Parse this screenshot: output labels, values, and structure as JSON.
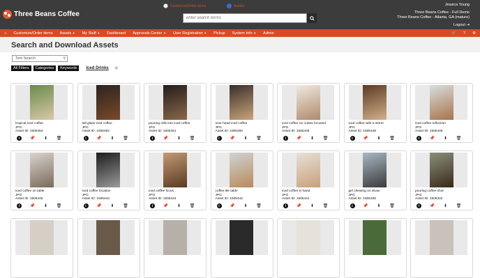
{
  "header": {
    "logo_text": "Three Beans Coffee",
    "radio_options": [
      {
        "label": "Customize/Order items",
        "selected": false
      },
      {
        "label": "Assets",
        "selected": true
      }
    ],
    "search_placeholder": "enter search terms",
    "user_name": "Jessica Young",
    "org_line1": "Three Beans Coffee - Full Demo",
    "org_line2": "Three Beans Coffee - Atlanta, GA (mature)",
    "logout": "Logout"
  },
  "nav": {
    "items": [
      "Customize/Order items",
      "Assets",
      "My Stuff",
      "Dashboard",
      "Approvals Center",
      "User Registration",
      "Pickup",
      "System Info",
      "Admin"
    ],
    "help": "?"
  },
  "page": {
    "title": "Search and Download Assets",
    "text_search_placeholder": "Text Search",
    "tabs": [
      "All Filters",
      "Categories",
      "Keywords"
    ],
    "active_filter": "Iced Drinks"
  },
  "assets": [
    {
      "name": "tropical iced coffee",
      "type": "JPG",
      "id": "Asset ID: 1505453",
      "c1": "#6a8a4a",
      "c2": "#d9c9a9"
    },
    {
      "name": "tall glass iced coffee",
      "type": "JPG",
      "id": "Asset ID: 1505452",
      "c1": "#2c2320",
      "c2": "#7a4a2a"
    },
    {
      "name": "pouring milk into iced coffee",
      "type": "JPG",
      "id": "Asset ID: 1505451",
      "c1": "#221c1a",
      "c2": "#8a6a4a"
    },
    {
      "name": "over head iced coffee",
      "type": "JPG",
      "id": "Asset ID: 1505450",
      "c1": "#3a2f2a",
      "c2": "#c9a47a"
    },
    {
      "name": "iced coffee ice cubes focused",
      "type": "JPG",
      "id": "Asset ID: 1505449",
      "c1": "#efe9e2",
      "c2": "#b08a6a"
    },
    {
      "name": "iced coffee with a stirrer",
      "type": "JPG",
      "id": "Asset ID: 1505448",
      "c1": "#5a3a22",
      "c2": "#d2b08a"
    },
    {
      "name": "iced coffee reflection",
      "type": "JPG",
      "id": "Asset ID: 1505446",
      "c1": "#d8dee0",
      "c2": "#a8734a"
    },
    {
      "name": "iced coffee on table",
      "type": "JPG",
      "id": "Asset ID: 1505445",
      "c1": "#d9d4cc",
      "c2": "#7a6a5a"
    },
    {
      "name": "iced coffee location",
      "type": "JPG",
      "id": "Asset ID: 1505444",
      "c1": "#1c1c1c",
      "c2": "#9a9a9a"
    },
    {
      "name": "iced coffee focus",
      "type": "JPG",
      "id": "Asset ID: 1505443",
      "c1": "#c29a74",
      "c2": "#5a3a22"
    },
    {
      "name": "coffee tile table",
      "type": "JPG",
      "id": "Asset ID: 1505442",
      "c1": "#d0d3d4",
      "c2": "#b88a5a"
    },
    {
      "name": "iced coffee in hand",
      "type": "JPG",
      "id": "Asset ID: 1505441",
      "c1": "#e6e1d8",
      "c2": "#c9a07a"
    },
    {
      "name": "girl chewing on straw",
      "type": "JPG",
      "id": "Asset ID: 1505338",
      "c1": "#a8b8c4",
      "c2": "#3a3a3a"
    },
    {
      "name": "pouring coffee shot",
      "type": "JPG",
      "id": "Asset ID: 1505322",
      "c1": "#8a8f7a",
      "c2": "#3a2a1a"
    }
  ],
  "partial_row_colors": [
    "#d6cfc6",
    "#6a5a4a",
    "#b7b0a8",
    "#2a2a2a",
    "#e6e2da",
    "#4a6a3a",
    "#c8c2ba"
  ],
  "colors": {
    "accent": "#d84a24",
    "topbar": "#3c3c3c"
  }
}
